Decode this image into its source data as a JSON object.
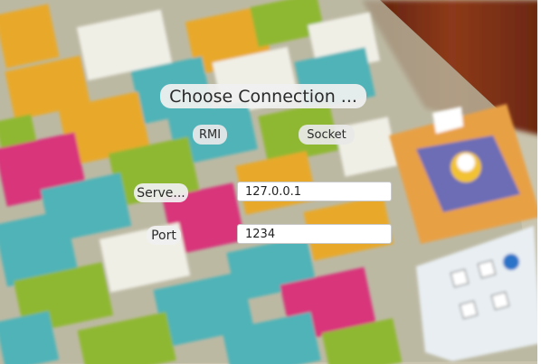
{
  "dialog": {
    "title": "Choose Connection ...",
    "connection_options": [
      {
        "label": "RMI"
      },
      {
        "label": "Socket"
      }
    ],
    "server": {
      "label": "Serve...",
      "value": "127.0.0.1"
    },
    "port": {
      "label": "Port",
      "value": "1234"
    }
  },
  "background": {
    "description_colors": {
      "teal": "#4fb3b8",
      "yellow": "#e8a92a",
      "green": "#8fb832",
      "pink": "#d8357a",
      "wood": "#8a3a1c",
      "scoreboard": "#e8eef2"
    }
  }
}
